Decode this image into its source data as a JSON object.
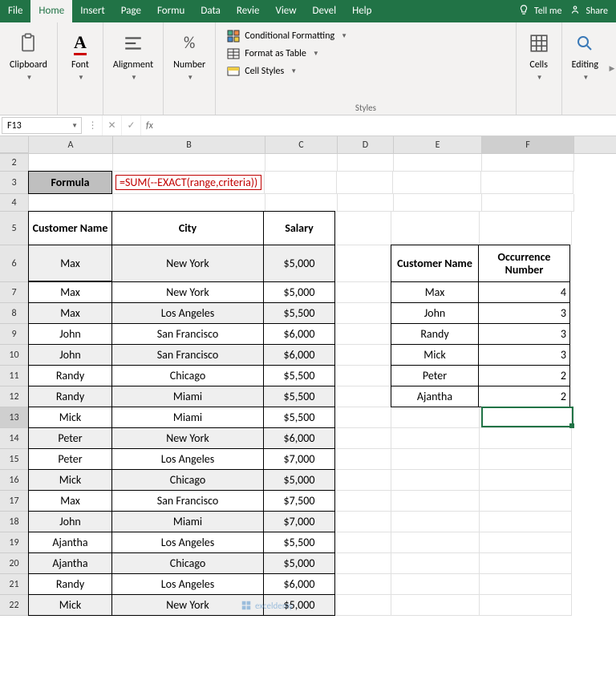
{
  "tabs": [
    "File",
    "Home",
    "Insert",
    "Page",
    "Formu",
    "Data",
    "Revie",
    "View",
    "Devel",
    "Help"
  ],
  "active_tab_index": 1,
  "tell_me": "Tell me",
  "share": "Share",
  "ribbon": {
    "clipboard": "Clipboard",
    "font": "Font",
    "alignment": "Alignment",
    "number": "Number",
    "styles": "Styles",
    "cells": "Cells",
    "editing": "Editing",
    "cond_fmt": "Conditional Formatting",
    "fmt_table": "Format as Table",
    "cell_styles": "Cell Styles"
  },
  "name_box": "F13",
  "formula_input": "",
  "columns": [
    "A",
    "B",
    "C",
    "D",
    "E",
    "F"
  ],
  "row_labels": [
    "2",
    "3",
    "4",
    "5",
    "6",
    "7",
    "8",
    "9",
    "10",
    "11",
    "12",
    "13",
    "14",
    "15",
    "16",
    "17",
    "18",
    "19",
    "20",
    "21",
    "22"
  ],
  "formula_row": {
    "label": "Formula",
    "value": "=SUM(--EXACT(range,criteria))"
  },
  "main_headers": {
    "name": "Customer Name",
    "city": "City",
    "salary": "Salary"
  },
  "side_headers": {
    "name": "Customer Name",
    "occ": "Occurrence Number"
  },
  "main_rows": [
    {
      "name": "Max",
      "city": "New York",
      "salary": "$5,000"
    },
    {
      "name": "Max",
      "city": "New York",
      "salary": "$5,000"
    },
    {
      "name": "Max",
      "city": "Los Angeles",
      "salary": "$5,500"
    },
    {
      "name": "John",
      "city": "San Francisco",
      "salary": "$6,000"
    },
    {
      "name": "John",
      "city": "San Francisco",
      "salary": "$6,000"
    },
    {
      "name": "Randy",
      "city": "Chicago",
      "salary": "$5,500"
    },
    {
      "name": "Randy",
      "city": "Miami",
      "salary": "$5,500"
    },
    {
      "name": "Mick",
      "city": "Miami",
      "salary": "$5,500"
    },
    {
      "name": "Peter",
      "city": "New York",
      "salary": "$6,000"
    },
    {
      "name": "Peter",
      "city": "Los Angeles",
      "salary": "$7,000"
    },
    {
      "name": "Mick",
      "city": "Chicago",
      "salary": "$5,000"
    },
    {
      "name": "Max",
      "city": "San Francisco",
      "salary": "$7,500"
    },
    {
      "name": "John",
      "city": "Miami",
      "salary": "$7,000"
    },
    {
      "name": "Ajantha",
      "city": "Los Angeles",
      "salary": "$5,500"
    },
    {
      "name": "Ajantha",
      "city": "Chicago",
      "salary": "$5,000"
    },
    {
      "name": "Randy",
      "city": "Los Angeles",
      "salary": "$6,000"
    },
    {
      "name": "Mick",
      "city": "New York",
      "salary": "$5,000"
    }
  ],
  "side_rows": [
    {
      "name": "Max",
      "count": "4"
    },
    {
      "name": "John",
      "count": "3"
    },
    {
      "name": "Randy",
      "count": "3"
    },
    {
      "name": "Mick",
      "count": "3"
    },
    {
      "name": "Peter",
      "count": "2"
    },
    {
      "name": "Ajantha",
      "count": "2"
    }
  ],
  "watermark": "exceldemy"
}
